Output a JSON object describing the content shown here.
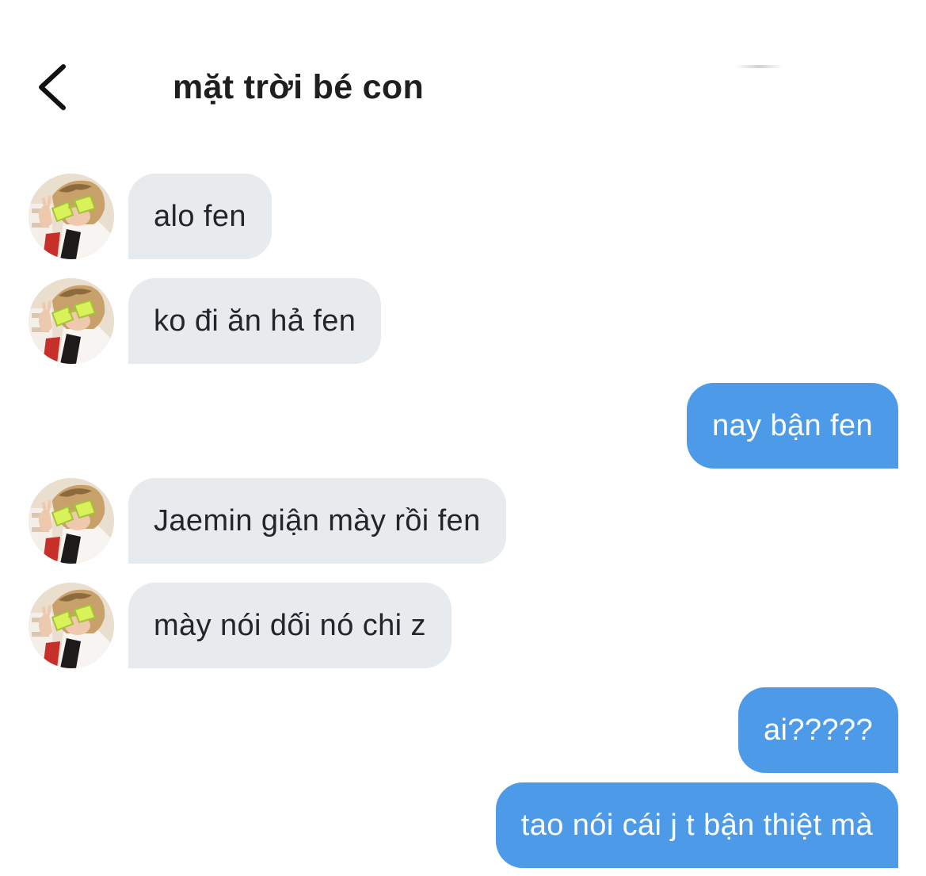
{
  "header": {
    "title": "mặt trời bé con"
  },
  "messages": [
    {
      "side": "incoming",
      "text": "alo fen"
    },
    {
      "side": "incoming",
      "text": "ko đi ăn hả fen"
    },
    {
      "side": "outgoing",
      "text": "nay bận fen"
    },
    {
      "side": "incoming",
      "text": "Jaemin giận mày rồi fen"
    },
    {
      "side": "incoming",
      "text": "mày nói dối nó chi z"
    },
    {
      "side": "outgoing",
      "text": "ai?????"
    },
    {
      "side": "outgoing",
      "text": "tao nói cái j t bận thiệt mà"
    }
  ],
  "colors": {
    "incoming_bubble": "#e7ebee",
    "outgoing_bubble": "#4d9be8",
    "text_dark": "#22262a",
    "text_light": "#ffffff"
  },
  "icons": {
    "back": "chevron-left-icon"
  }
}
